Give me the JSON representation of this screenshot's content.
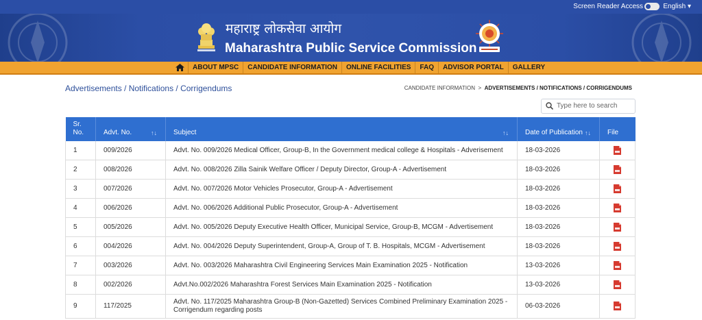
{
  "topbar": {
    "screen_reader_label": "Screen Reader Access",
    "language": "English ▾"
  },
  "header": {
    "title_marathi": "महाराष्ट्र लोकसेवा आयोग",
    "title_english": "Maharashtra Public Service Commission",
    "background_color": "#2b4ea6"
  },
  "nav": {
    "background_color": "#f0a330",
    "home_icon": "home-icon",
    "items": [
      {
        "label": "ABOUT MPSC"
      },
      {
        "label": "CANDIDATE INFORMATION"
      },
      {
        "label": "ONLINE FACILITIES"
      },
      {
        "label": "FAQ"
      },
      {
        "label": "ADVISOR PORTAL"
      },
      {
        "label": "GALLERY"
      }
    ]
  },
  "page": {
    "heading": "Advertisements / Notifications / Corrigendums",
    "breadcrumb": {
      "parent": "CANDIDATE INFORMATION",
      "separator": ">",
      "current": "ADVERTISEMENTS / NOTIFICATIONS / CORRIGENDUMS"
    },
    "search_placeholder": "Type here to search"
  },
  "table": {
    "header_color": "#2f6fd0",
    "columns": [
      {
        "label": "Sr. No."
      },
      {
        "label": "Advt. No.",
        "sortable": true
      },
      {
        "label": "Subject",
        "sortable": true
      },
      {
        "label": "Date of Publication",
        "sortable": true
      },
      {
        "label": "File"
      }
    ],
    "sort_glyph": "↑↓",
    "rows": [
      {
        "sr": "1",
        "advt": "009/2026",
        "subject": "Advt. No. 009/2026 Medical Officer, Group-B, In the Government medical college & Hospitals - Adverisement",
        "date": "18-03-2026",
        "file_icon": "pdf-icon"
      },
      {
        "sr": "2",
        "advt": "008/2026",
        "subject": "Advt. No. 008/2026 Zilla Sainik Welfare Officer / Deputy Director, Group-A - Advertisement",
        "date": "18-03-2026",
        "file_icon": "pdf-icon"
      },
      {
        "sr": "3",
        "advt": "007/2026",
        "subject": "Advt. No. 007/2026 Motor Vehicles Prosecutor, Group-A - Advertisement",
        "date": "18-03-2026",
        "file_icon": "pdf-icon"
      },
      {
        "sr": "4",
        "advt": "006/2026",
        "subject": "Advt. No. 006/2026 Additional Public Prosecutor, Group-A - Advertisement",
        "date": "18-03-2026",
        "file_icon": "pdf-icon"
      },
      {
        "sr": "5",
        "advt": "005/2026",
        "subject": "Advt. No. 005/2026 Deputy Executive Health Officer, Municipal Service, Group-B, MCGM - Advertisement",
        "date": "18-03-2026",
        "file_icon": "pdf-icon"
      },
      {
        "sr": "6",
        "advt": "004/2026",
        "subject": "Advt. No. 004/2026 Deputy Superintendent, Group-A, Group of T. B. Hospitals, MCGM - Advertisement",
        "date": "18-03-2026",
        "file_icon": "pdf-icon"
      },
      {
        "sr": "7",
        "advt": "003/2026",
        "subject": "Advt. No. 003/2026 Maharashtra Civil Engineering Services Main Examination 2025 - Notification",
        "date": "13-03-2026",
        "file_icon": "pdf-icon"
      },
      {
        "sr": "8",
        "advt": "002/2026",
        "subject": "Advt.No.002/2026 Maharashtra Forest Services Main Examination 2025 - Notification",
        "date": "13-03-2026",
        "file_icon": "pdf-icon"
      },
      {
        "sr": "9",
        "advt": "117/2025",
        "subject": "Advt. No. 117/2025 Maharashtra Group-B (Non-Gazetted) Services Combined Preliminary Examination 2025 - Corrigendum regarding posts",
        "date": "06-03-2026",
        "file_icon": "pdf-icon"
      }
    ]
  }
}
